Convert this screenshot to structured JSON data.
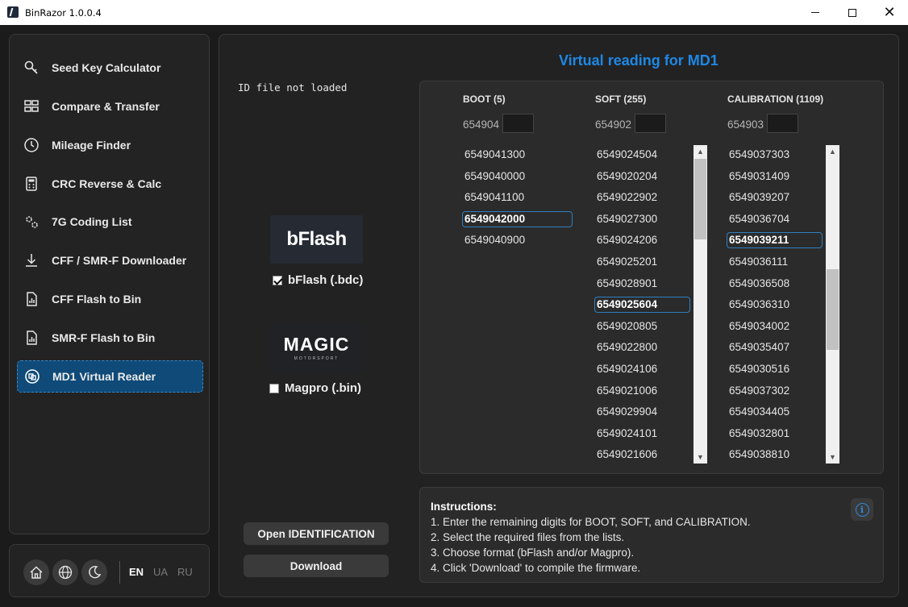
{
  "window": {
    "title": "BinRazor 1.0.0.4"
  },
  "sidebar": {
    "items": [
      {
        "label": "Seed Key Calculator",
        "icon": "key-search-icon"
      },
      {
        "label": "Compare & Transfer",
        "icon": "compare-icon"
      },
      {
        "label": "Mileage Finder",
        "icon": "clock-icon"
      },
      {
        "label": "CRC Reverse & Calc",
        "icon": "calculator-icon"
      },
      {
        "label": "7G Coding List",
        "icon": "gears-icon"
      },
      {
        "label": "CFF / SMR-F Downloader",
        "icon": "download-icon"
      },
      {
        "label": "CFF Flash to Bin",
        "icon": "file-chart-icon"
      },
      {
        "label": "SMR-F Flash to Bin",
        "icon": "file-chart-icon"
      },
      {
        "label": "MD1 Virtual Reader",
        "icon": "chip-icon",
        "active": true
      }
    ]
  },
  "footer": {
    "languages": [
      "EN",
      "UA",
      "RU"
    ],
    "active_language": "EN"
  },
  "main": {
    "heading": "Virtual reading for MD1",
    "id_status": "ID file not loaded",
    "bflash": {
      "logo": "bFlash",
      "label": "bFlash (.bdc)",
      "checked": true
    },
    "magpro": {
      "logo": "MAGIC",
      "logo_sub": "MOTORSPORT",
      "label": "Magpro (.bin)",
      "checked": false
    },
    "open_button": "Open IDENTIFICATION",
    "download_button": "Download"
  },
  "columns": [
    {
      "header": "BOOT (5)",
      "prefix": "654904",
      "selected": "6549042000",
      "items": [
        "6549041300",
        "6549040000",
        "6549041100",
        "6549042000",
        "6549040900"
      ]
    },
    {
      "header": "SOFT (255)",
      "prefix": "654902",
      "selected": "6549025604",
      "items": [
        "6549024504",
        "6549020204",
        "6549022902",
        "6549027300",
        "6549024206",
        "6549025201",
        "6549028901",
        "6549025604",
        "6549020805",
        "6549022800",
        "6549024106",
        "6549021006",
        "6549029904",
        "6549024101",
        "6549021606"
      ]
    },
    {
      "header": "CALIBRATION (1109)",
      "prefix": "654903",
      "selected": "6549039211",
      "items": [
        "6549037303",
        "6549031409",
        "6549039207",
        "6549036704",
        "6549039211",
        "6549036111",
        "6549036508",
        "6549036310",
        "6549034002",
        "6549035407",
        "6549030516",
        "6549037302",
        "6549034405",
        "6549032801",
        "6549038810"
      ]
    }
  ],
  "instructions": {
    "title": "Instructions:",
    "lines": [
      "1. Enter the remaining digits for BOOT, SOFT, and CALIBRATION.",
      "2. Select the required files from the lists.",
      "3. Choose format (bFlash and/or Magpro).",
      "4. Click 'Download' to compile the firmware."
    ]
  },
  "colors": {
    "accent": "#1e88e5",
    "active_nav": "#0f4a78",
    "background": "#1b1b1b"
  }
}
